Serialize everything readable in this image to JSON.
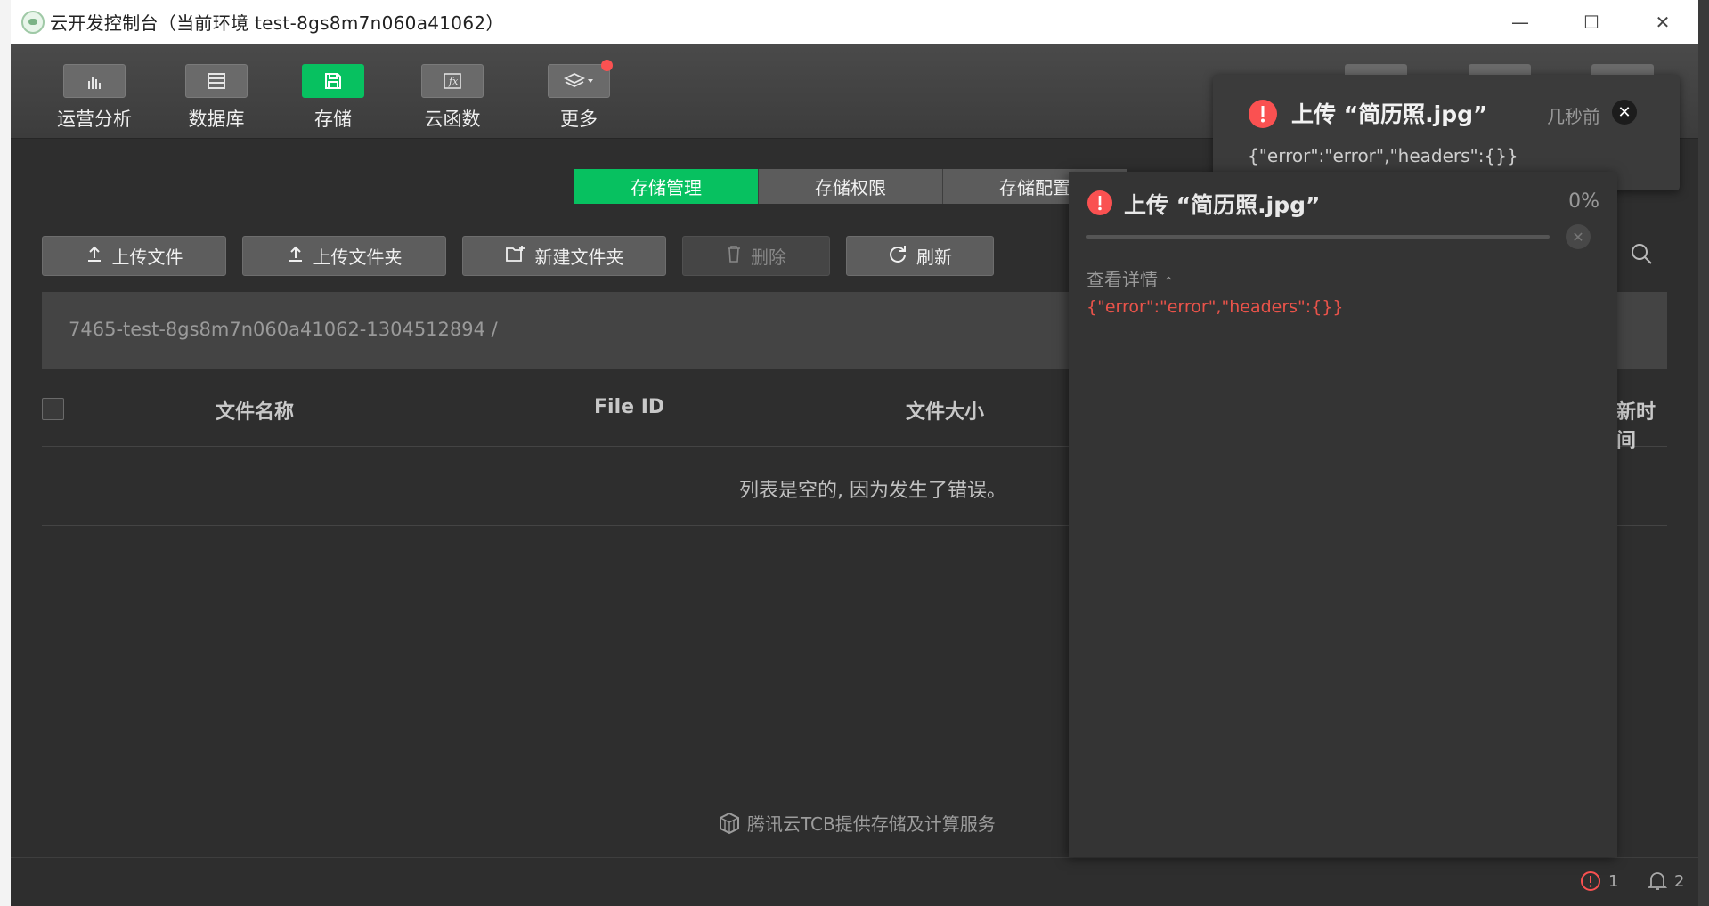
{
  "window": {
    "title": "云开发控制台（当前环境 test-8gs8m7n060a41062）",
    "minimize_glyph": "—",
    "maximize_glyph": "☐",
    "close_glyph": "✕"
  },
  "toolbar": {
    "items": [
      {
        "label": "运营分析",
        "icon": "bar-chart-icon"
      },
      {
        "label": "数据库",
        "icon": "database-icon"
      },
      {
        "label": "存储",
        "icon": "save-icon",
        "active": true
      },
      {
        "label": "云函数",
        "icon": "function-icon"
      },
      {
        "label": "更多",
        "icon": "layers-icon",
        "has_dot": true
      }
    ]
  },
  "tabs": [
    {
      "label": "存储管理",
      "active": true
    },
    {
      "label": "存储权限"
    },
    {
      "label": "存储配置"
    }
  ],
  "actions": {
    "upload_file": "上传文件",
    "upload_folder": "上传文件夹",
    "new_folder": "新建文件夹",
    "delete": "删除",
    "refresh": "刷新"
  },
  "path": "7465-test-8gs8m7n060a41062-1304512894  /",
  "table": {
    "columns": [
      "文件名称",
      "File ID",
      "文件大小",
      "新时间"
    ],
    "empty_message": "列表是空的, 因为发生了错误。"
  },
  "footer": "腾讯云TCB提供存储及计算服务",
  "status": {
    "errors": "1",
    "notifications": "2"
  },
  "toast": {
    "title": "上传 “简历照.jpg”",
    "time": "几秒前",
    "message": "{\"error\":\"error\",\"headers\":{}}"
  },
  "upload_panel": {
    "title": "上传 “简历照.jpg”",
    "percent": "0%",
    "progress": 0,
    "detail_toggle": "查看详情",
    "detail_message": "{\"error\":\"error\",\"headers\":{}}"
  },
  "colors": {
    "accent": "#07c160",
    "error": "#fa5151",
    "error_text": "#e9534a"
  }
}
